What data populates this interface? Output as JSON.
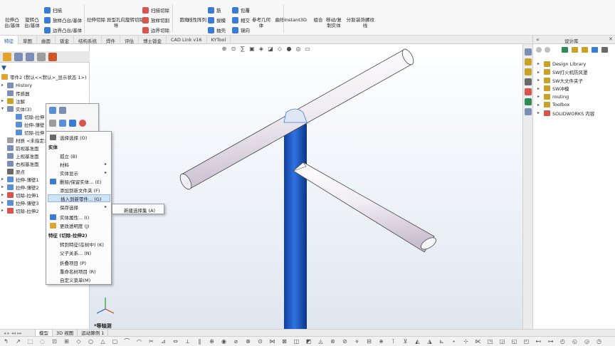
{
  "ribbon": {
    "groups": [
      {
        "label": "拉伸凸台/基体",
        "color": "#3a7bd5"
      },
      {
        "label": "旋转凸台/基体",
        "color": "#3a7bd5"
      },
      {
        "label": "拉伸切除",
        "color": "#d9534f"
      },
      {
        "label": "异型孔向导",
        "color": "#d9534f"
      },
      {
        "label": "旋转切除",
        "color": "#d9534f"
      },
      {
        "label": "圆角",
        "color": "#3a7bd5"
      },
      {
        "label": "线性阵列",
        "color": "#3a7bd5"
      },
      {
        "label": "参考几何体",
        "color": "#6a6a6a"
      },
      {
        "label": "曲线",
        "color": "#6a6a6a"
      },
      {
        "label": "Instant3D",
        "color": "#2e8b57"
      },
      {
        "label": "组合",
        "color": "#3a7bd5"
      },
      {
        "label": "移动/复制实体",
        "color": "#3a7bd5"
      },
      {
        "label": "分割",
        "color": "#3a7bd5"
      },
      {
        "label": "装饰螺纹线",
        "color": "#6a6a6a"
      }
    ],
    "small": {
      "sweep": "扫描",
      "loft": "放样凸台/基体",
      "boundary": "边界凸台/基体",
      "sweep_cut": "扫描切除",
      "loft_cut": "放样切割",
      "boundary_cut": "边界切除",
      "rib": "筋",
      "draft": "拔模",
      "shell": "抽壳",
      "wrap": "包覆",
      "intersect": "相交",
      "mirror": "镜向"
    }
  },
  "tabs": [
    "特征",
    "草图",
    "曲面",
    "钣金",
    "结构系统",
    "焊件",
    "评估",
    "博士钣金",
    "CAD Link v16",
    "KYTool"
  ],
  "tree": {
    "root": "零件2 (默认<<默认>_显示状态 1>)",
    "items": [
      {
        "label": "History",
        "arrow": "▸",
        "color": "#7a8fb3"
      },
      {
        "label": "传感器",
        "arrow": "",
        "color": "#7a8fb3"
      },
      {
        "label": "注解",
        "arrow": "▸",
        "color": "#c9a227"
      },
      {
        "label": "实体(3)",
        "arrow": "▾",
        "color": "#7a8fb3"
      },
      {
        "label": "切除-拉伸",
        "arrow": "",
        "color": "#5a8fd6"
      },
      {
        "label": "拉伸-薄壁",
        "arrow": "",
        "color": "#5a8fd6"
      },
      {
        "label": "切除-拉伸",
        "arrow": "",
        "color": "#5a8fd6"
      },
      {
        "label": "材质 <未指定>",
        "arrow": "",
        "color": "#a0a0a0"
      },
      {
        "label": "前视基准面",
        "arrow": "",
        "color": "#7a8fb3"
      },
      {
        "label": "上视基准面",
        "arrow": "",
        "color": "#7a8fb3"
      },
      {
        "label": "右视基准面",
        "arrow": "",
        "color": "#7a8fb3"
      },
      {
        "label": "原点",
        "arrow": "",
        "color": "#6a6a6a"
      },
      {
        "label": "拉伸-薄壁1",
        "arrow": "▸",
        "color": "#5a8fd6"
      },
      {
        "label": "拉伸-薄壁2",
        "arrow": "▸",
        "color": "#5a8fd6"
      },
      {
        "label": "切除-拉伸1",
        "arrow": "▸",
        "color": "#d9534f"
      },
      {
        "label": "拉伸-薄壁3",
        "arrow": "▸",
        "color": "#5a8fd6"
      },
      {
        "label": "切除-拉伸2",
        "arrow": "▸",
        "color": "#d9534f"
      }
    ]
  },
  "context_menu": {
    "header_top": "实体",
    "header_feature": "特征 (切除-拉伸2)",
    "items_a": [
      {
        "label": "选择选择 (O)",
        "sub": ""
      }
    ],
    "items_b": [
      {
        "label": "孤立 (B)",
        "sub": ""
      },
      {
        "label": "材料",
        "sub": "▸"
      },
      {
        "label": "实体显示",
        "sub": "▸"
      },
      {
        "label": "删除/保留实体... (E)",
        "sub": ""
      },
      {
        "label": "添加到新文件夹 (F)",
        "sub": ""
      },
      {
        "label": "插入到新零件... (G)",
        "sub": ""
      },
      {
        "label": "保存选择",
        "sub": "▸"
      },
      {
        "label": "实体属性... (I)",
        "sub": ""
      },
      {
        "label": "更改透明度 (J)",
        "sub": ""
      }
    ],
    "items_c": [
      {
        "label": "转到特征(在树中) (K)",
        "sub": ""
      },
      {
        "label": "父子关系... (N)",
        "sub": ""
      },
      {
        "label": "折叠项目 (P)",
        "sub": ""
      },
      {
        "label": "重命名树项目 (R)",
        "sub": ""
      },
      {
        "label": "自定义菜单(M)",
        "sub": ""
      }
    ],
    "submenu": "新建选择集 (A)"
  },
  "task_pane": {
    "title": "设计库",
    "items": [
      {
        "label": "Design Library",
        "color": "#c9a227"
      },
      {
        "label": "SW打火机防风罩",
        "color": "#c9a227"
      },
      {
        "label": "SW大文件夹子",
        "color": "#c9a227"
      },
      {
        "label": "SW冲模",
        "color": "#c9a227"
      },
      {
        "label": "routing",
        "color": "#c9a227"
      },
      {
        "label": "Toolbox",
        "color": "#c9a227"
      },
      {
        "label": "SOLIDWORKS 内容",
        "color": "#d9534f"
      }
    ]
  },
  "viewport": {
    "view_label": "*等轴测"
  },
  "bottom_tabs": [
    "模型",
    "3D 视图",
    "运动算例 1"
  ]
}
